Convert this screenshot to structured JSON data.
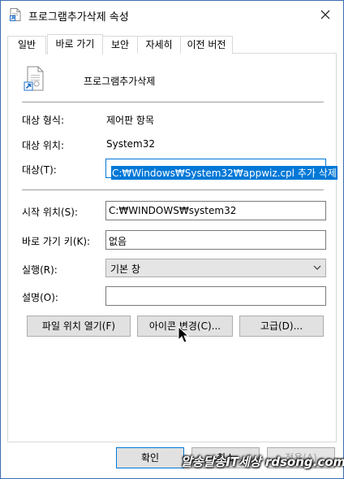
{
  "window": {
    "title": "프로그램추가삭제 속성"
  },
  "tabs": [
    {
      "label": "일반"
    },
    {
      "label": "바로 가기"
    },
    {
      "label": "보안"
    },
    {
      "label": "자세히"
    },
    {
      "label": "이전 버전"
    }
  ],
  "shortcut": {
    "name": "프로그램추가삭제",
    "target_type_label": "대상 형식:",
    "target_type_value": "제어판 항목",
    "target_location_label": "대상 위치:",
    "target_location_value": "System32",
    "target_label": "대상(T):",
    "target_value": "C:₩Windows₩System32₩appwiz.cpl 추가 삭제",
    "start_in_label": "시작 위치(S):",
    "start_in_value": "C:₩WINDOWS₩system32",
    "shortcut_key_label": "바로 가기 키(K):",
    "shortcut_key_value": "없음",
    "run_label": "실행(R):",
    "run_value": "기본 창",
    "comment_label": "설명(O):",
    "comment_value": ""
  },
  "buttons": {
    "open_location": "파일 위치 열기(F)",
    "change_icon": "아이콘 변경(C)...",
    "advanced": "고급(D)...",
    "ok": "확인",
    "cancel": "취소",
    "apply": "적용(A)"
  },
  "watermark": "알송달송IT세상 rdsong.com",
  "colors": {
    "accent": "#0078d7",
    "button_face": "#e1e1e1",
    "border": "#adadad"
  }
}
